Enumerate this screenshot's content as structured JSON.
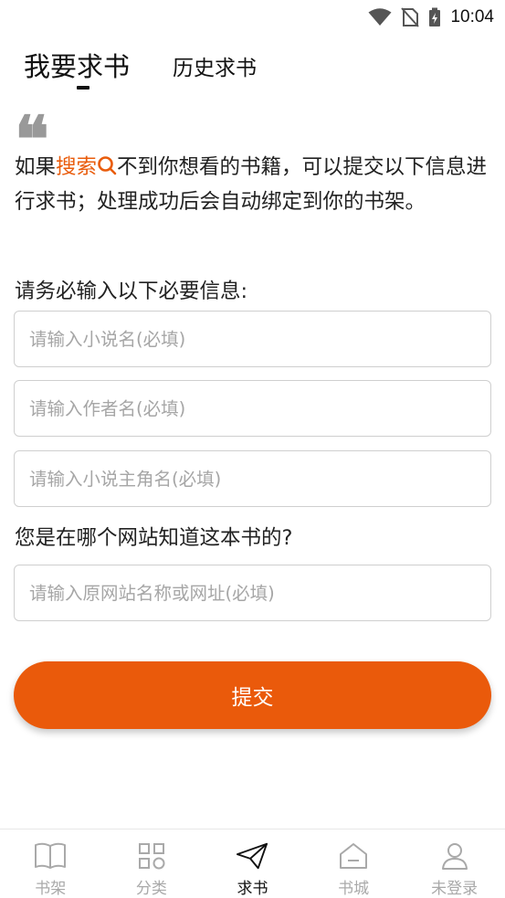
{
  "status_bar": {
    "time": "10:04"
  },
  "tabs": {
    "active_label": "我要求书",
    "history_label": "历史求书"
  },
  "quote_mark": "❝",
  "intro": {
    "before": "如果",
    "search_link": "搜索",
    "after": "不到你想看的书籍，可以提交以下信息进行求书；处理成功后会自动绑定到你的书架。"
  },
  "form": {
    "required_heading": "请务必输入以下必要信息:",
    "novel_placeholder": "请输入小说名(必填)",
    "author_placeholder": "请输入作者名(必填)",
    "protagonist_placeholder": "请输入小说主角名(必填)",
    "source_question": "您是在哪个网站知道这本书的?",
    "site_placeholder": "请输入原网站名称或网址(必填)",
    "submit_label": "提交"
  },
  "bottom_nav": {
    "items": [
      {
        "label": "书架",
        "icon": "book-icon"
      },
      {
        "label": "分类",
        "icon": "grid-icon"
      },
      {
        "label": "求书",
        "icon": "paper-plane-icon"
      },
      {
        "label": "书城",
        "icon": "store-icon"
      },
      {
        "label": "未登录",
        "icon": "user-icon"
      }
    ],
    "active_index": 2
  },
  "colors": {
    "accent": "#ea5a0b",
    "inactive": "#a9a9a9"
  }
}
